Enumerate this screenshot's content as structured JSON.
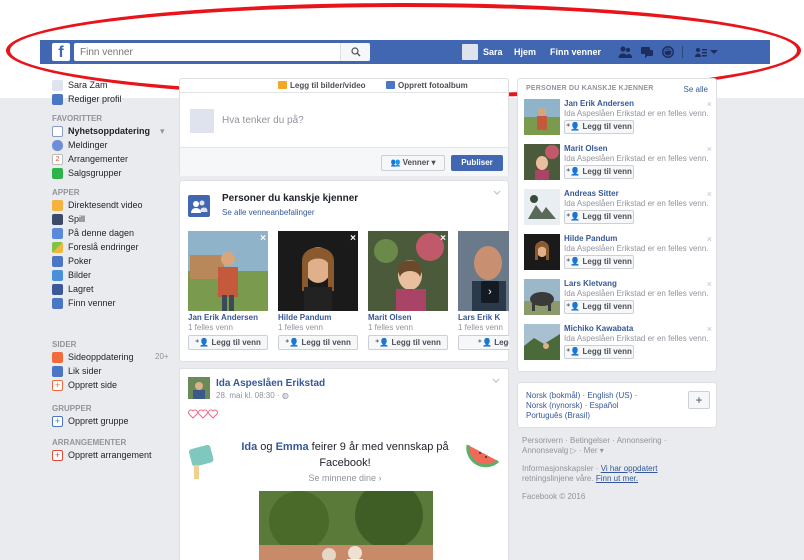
{
  "topbar": {
    "logo": "f",
    "search_placeholder": "Finn venner",
    "user_name": "Sara",
    "home": "Hjem",
    "find_friends": "Finn venner"
  },
  "sidebar": {
    "profile_name": "Sara Zam",
    "edit_profile": "Rediger profil",
    "favorites_heading": "FAVORITTER",
    "favorites": [
      "Nyhetsoppdatering",
      "Meldinger",
      "Arrangementer",
      "Salgsgrupper"
    ],
    "apps_heading": "APPER",
    "apps": [
      "Direktesendt video",
      "Spill",
      "På denne dagen",
      "Foreslå endringer",
      "Poker",
      "Bilder",
      "Lagret",
      "Finn venner"
    ],
    "pages_heading": "SIDER",
    "pages": [
      "Sideoppdatering",
      "Lik sider",
      "Opprett side"
    ],
    "pages_badge": "20+",
    "groups_heading": "GRUPPER",
    "groups": [
      "Opprett gruppe"
    ],
    "events_heading": "ARRANGEMENTER",
    "events": [
      "Opprett arrangement"
    ],
    "events_date_icon": "2"
  },
  "composer": {
    "tab_photo": "Legg til bilder/video",
    "tab_album": "Opprett fotoalbum",
    "placeholder": "Hva tenker du på?",
    "audience": "Venner",
    "publish": "Publiser"
  },
  "pymk": {
    "title": "Personer du kanskje kjenner",
    "see_all": "Se alle venneanbefalinger",
    "people": [
      {
        "name": "Jan Erik Andersen",
        "mutual": "1 felles venn",
        "add": "Legg til venn"
      },
      {
        "name": "Hilde Pandum",
        "mutual": "1 felles venn",
        "add": "Legg til venn"
      },
      {
        "name": "Marit Olsen",
        "mutual": "1 felles venn",
        "add": "Legg til venn"
      },
      {
        "name": "Lars Erik K",
        "mutual": "1 felles venn",
        "add": "Legg t"
      }
    ]
  },
  "post": {
    "author": "Ida Aspeslåen Erikstad",
    "meta": "28. mai kl. 08:30 ·",
    "memory_name1": "Ida",
    "memory_og": " og ",
    "memory_name2": "Emma",
    "memory_rest": " feirer 9 år med vennskap på Facebook!",
    "memory_link": "Se minnene dine"
  },
  "right_pymk": {
    "title": "PERSONER DU KANSKJE KJENNER",
    "see_all": "Se alle",
    "people": [
      {
        "name": "Jan Erik Andersen",
        "mutual": "Ida Aspeslåen Erikstad er en felles venn.",
        "add": "Legg til venn"
      },
      {
        "name": "Marit Olsen",
        "mutual": "Ida Aspeslåen Erikstad er en felles venn.",
        "add": "Legg til venn"
      },
      {
        "name": "Andreas Sitter",
        "mutual": "Ida Aspeslåen Erikstad er en felles venn.",
        "add": "Legg til venn"
      },
      {
        "name": "Hilde Pandum",
        "mutual": "Ida Aspeslåen Erikstad er en felles venn.",
        "add": "Legg til venn"
      },
      {
        "name": "Lars Kletvang",
        "mutual": "Ida Aspeslåen Erikstad er en felles venn.",
        "add": "Legg til venn"
      },
      {
        "name": "Michiko Kawabata",
        "mutual": "Ida Aspeslåen Erikstad er en felles venn.",
        "add": "Legg til venn"
      }
    ]
  },
  "languages": {
    "line1": "Norsk (bokmål) · English (US) ·",
    "line2": "Norsk (nynorsk) · Español",
    "line3": "Português (Brasil)",
    "plus": "+"
  },
  "footer": {
    "line1": "Personvern · Betingelser · Annonsering ·",
    "line2": "Annonsevalg ▷ · Mer ▾",
    "line3": "Informasjonskapsler ·",
    "line3_link": "Vi har oppdatert",
    "line4": "retningslinjene våre.",
    "line4_link": "Finn ut mer.",
    "copyright": "Facebook © 2016"
  }
}
